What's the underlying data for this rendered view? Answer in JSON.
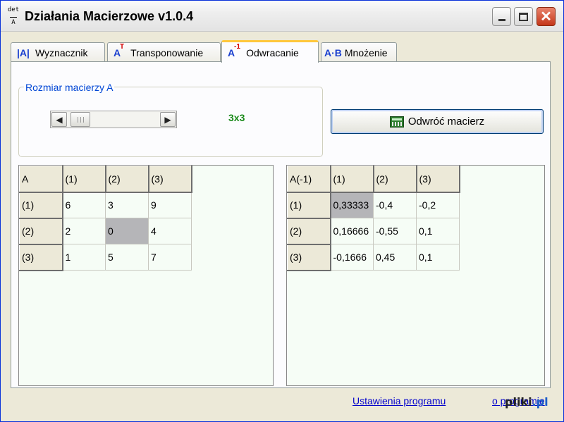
{
  "window": {
    "title": "Działania Macierzowe v1.0.4",
    "icon_top": "det",
    "icon_bottom": "A"
  },
  "tabs": [
    {
      "icon": "|A|",
      "label": "Wyznacznik"
    },
    {
      "icon": "A",
      "icon_sup": "T",
      "label": "Transponowanie"
    },
    {
      "icon": "A",
      "icon_sup": "-1",
      "label": "Odwracanie"
    },
    {
      "icon": "A·B",
      "label": "Mnożenie"
    }
  ],
  "size_group": {
    "label": "Rozmiar macierzy A",
    "value": "3x3"
  },
  "invert_button": {
    "label": "Odwróć macierz"
  },
  "matrix_a": {
    "corner": "A",
    "col_headers": [
      "(1)",
      "(2)",
      "(3)"
    ],
    "rows": [
      {
        "header": "(1)",
        "cells": [
          "6",
          "3",
          "9"
        ]
      },
      {
        "header": "(2)",
        "cells": [
          "2",
          "0",
          "4"
        ]
      },
      {
        "header": "(3)",
        "cells": [
          "1",
          "5",
          "7"
        ]
      }
    ]
  },
  "matrix_inverse": {
    "corner": "A(-1)",
    "col_headers": [
      "(1)",
      "(2)",
      "(3)"
    ],
    "rows": [
      {
        "header": "(1)",
        "cells": [
          "0,33333",
          "-0,4",
          "-0,2"
        ]
      },
      {
        "header": "(2)",
        "cells": [
          "0,16666",
          "-0,55",
          "0,1"
        ]
      },
      {
        "header": "(3)",
        "cells": [
          "-0,1666",
          "0,45",
          "0,1"
        ]
      }
    ]
  },
  "footer": {
    "settings_link": "Ustawienia programu",
    "about_link": "o programie",
    "watermark": "pliki",
    "watermark_suffix": ".pl"
  },
  "colors": {
    "accent_tab": "#ffc83c",
    "group_label": "#0046d5",
    "size_value": "#1a8a1a",
    "grid_bg": "#f6fdf6",
    "selected_cell": "#b5b5b8"
  }
}
